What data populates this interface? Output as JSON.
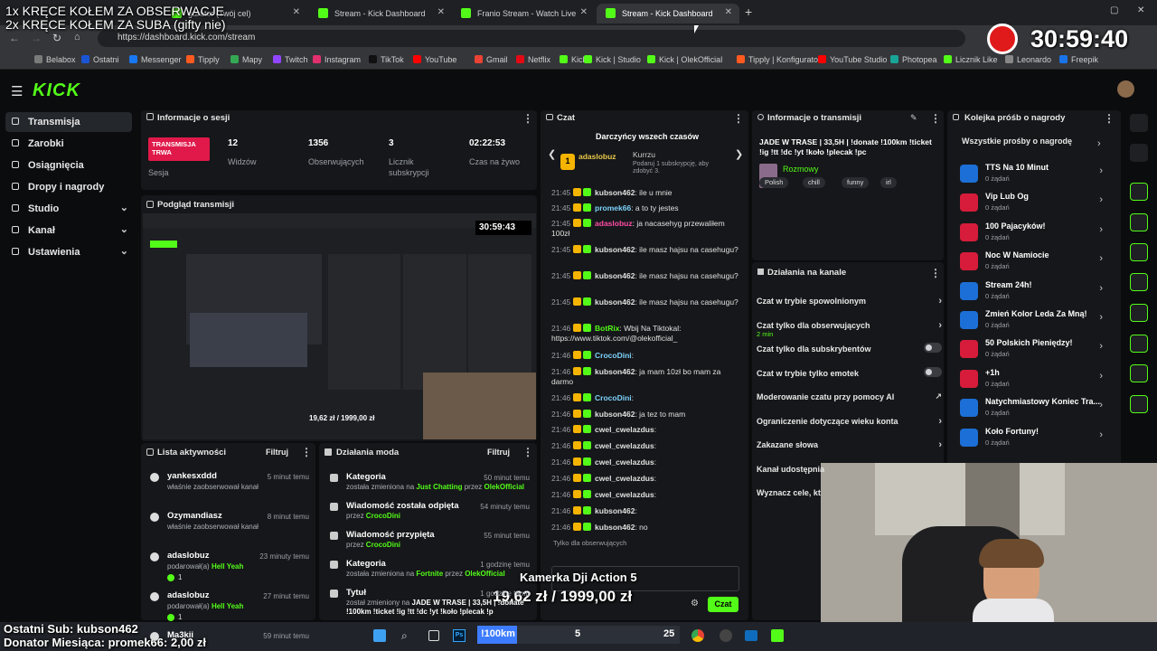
{
  "overlay": {
    "line1": "1x KRĘCE KOŁEM ZA OBSERWACJE",
    "line2": "2x KRĘCE KOŁEM ZA SUBA (gifty nie)",
    "timer": "30:59:40",
    "last_sub": "Ostatni Sub: kubson462",
    "donor": "Donator Miesiąca: promek66: 2,00 zł",
    "goal_title": "Kamerka Dji Action 5",
    "goal_value": "19,62 zł / 1999,00 zł",
    "km_label": "!100km",
    "km_value": "5",
    "km_right": "25"
  },
  "browser": {
    "tabs": [
      {
        "label": "gurator (Twój cel)",
        "active": false
      },
      {
        "label": "Stream - Kick Dashboard",
        "active": false
      },
      {
        "label": "Franio Stream - Watch Live",
        "active": false
      },
      {
        "label": "Stream - Kick Dashboard",
        "active": true
      }
    ],
    "url": "https://dashboard.kick.com/stream",
    "bookmarks": [
      "Belabox",
      "Ostatni",
      "Messenger",
      "Tipply",
      "Mapy",
      "Twitch",
      "Instagram",
      "TikTok",
      "YouTube",
      "Gmail",
      "Netflix",
      "Kick",
      "Kick | Studio",
      "Kick | OlekOfficial",
      "Tipply | Konfigurato...",
      "YouTube Studio",
      "Photopea",
      "Licznik Like",
      "Leonardo",
      "Freepik"
    ],
    "bookmark_colors": [
      "#7a7a7a",
      "#1a55d6",
      "#1877f2",
      "#ff5a1f",
      "#34a853",
      "#9146ff",
      "#e1306c",
      "#111111",
      "#ff0000",
      "#ea4335",
      "#e50914",
      "#53fc18",
      "#53fc18",
      "#53fc18",
      "#ff5a1f",
      "#ff0000",
      "#18a497",
      "#53fc18",
      "#888888",
      "#1a73e8"
    ]
  },
  "kick": {
    "logo": "KICK",
    "nav": [
      {
        "label": "Transmisja",
        "selected": true,
        "chevron": false
      },
      {
        "label": "Zarobki",
        "selected": false,
        "chevron": false
      },
      {
        "label": "Osiągnięcia",
        "selected": false,
        "chevron": false
      },
      {
        "label": "Dropy i nagrody",
        "selected": false,
        "chevron": false
      },
      {
        "label": "Studio",
        "selected": false,
        "chevron": true
      },
      {
        "label": "Kanał",
        "selected": false,
        "chevron": true
      },
      {
        "label": "Ustawienia",
        "selected": false,
        "chevron": true
      }
    ]
  },
  "session": {
    "title": "Informacje o sesji",
    "live_badge": "TRANSMISJA TRWA",
    "live_label": "Sesja",
    "stats": [
      {
        "value": "12",
        "label": "Widzów"
      },
      {
        "value": "1356",
        "label": "Obserwujących"
      },
      {
        "value": "3",
        "label": "Licznik subskrypcji"
      },
      {
        "value": "02:22:53",
        "label": "Czas na żywo"
      }
    ]
  },
  "preview": {
    "title": "Podgląd transmisji",
    "timer": "30:59:43",
    "amount": "19,62 zł / 1999,00 zł"
  },
  "activity": {
    "title": "Lista aktywności",
    "filter": "Filtruj",
    "items": [
      {
        "name": "yankesxddd",
        "sub": "właśnie zaobserwował kanał",
        "time": "5 minut temu",
        "extra": ""
      },
      {
        "name": "Ozymandiasz",
        "sub": "właśnie zaobserwował kanał",
        "time": "8 minut temu",
        "extra": ""
      },
      {
        "name": "adaslobuz",
        "sub": "podarował(a)",
        "gift": "Hell Yeah",
        "time": "23 minuty temu",
        "extra": "1"
      },
      {
        "name": "adaslobuz",
        "sub": "podarował(a)",
        "gift": "Hell Yeah",
        "time": "27 minut temu",
        "extra": "1"
      },
      {
        "name": "Ma3kii",
        "sub": "",
        "time": "59 minut temu",
        "extra": ""
      }
    ]
  },
  "mod": {
    "title": "Działania moda",
    "filter": "Filtruj",
    "items": [
      {
        "name": "Kategoria",
        "sub": "została zmieniona na",
        "hl": "Just Chatting",
        "by": "przez",
        "user": "OlekOfficial",
        "time": "50 minut temu"
      },
      {
        "name": "Wiadomość została odpięta",
        "sub": "przez",
        "hl": "",
        "by": "",
        "user": "CrocoDini",
        "time": "54 minuty temu"
      },
      {
        "name": "Wiadomość przypięta",
        "sub": "przez",
        "hl": "",
        "by": "",
        "user": "CrocoDini",
        "time": "55 minut temu"
      },
      {
        "name": "Kategoria",
        "sub": "została zmieniona na",
        "hl": "Fortnite",
        "by": "przez",
        "user": "OlekOfficial",
        "time": "1 godzinę temu"
      },
      {
        "name": "Tytuł",
        "sub": "został zmieniony na",
        "hl": "JADE W TRASE | 33,5H | !donate !100km !ticket !ig !tt !dc !yt !koło !plecak !p",
        "by": "",
        "user": "",
        "time": "1 godzinę temu"
      }
    ]
  },
  "chat": {
    "title": "Czat",
    "top_title": "Darczyńcy wszech czasów",
    "top1": "adaslobuz",
    "top2": "Kurrzu",
    "top2_sub": "Podaruj 1 subskrypcję, aby zdobyć 3.",
    "messages": [
      {
        "t": "21:45",
        "user": "kubson462",
        "color": "#e0e0e0",
        "msg": ": ile u mnie"
      },
      {
        "t": "21:45",
        "user": "promek66",
        "color": "#7dd3fc",
        "msg": ": a to ty jestes"
      },
      {
        "t": "21:45",
        "user": "adaslobuz",
        "color": "#ff4da6",
        "msg": ": ja nacasehyg przewaliłem 100zł"
      },
      {
        "t": "21:45",
        "user": "kubson462",
        "color": "#e0e0e0",
        "msg": ": ile masz hajsu na casehugu?"
      },
      {
        "t": "21:45",
        "user": "kubson462",
        "color": "#e0e0e0",
        "msg": ": ile masz hajsu na casehugu?"
      },
      {
        "t": "21:45",
        "user": "kubson462",
        "color": "#e0e0e0",
        "msg": ": ile masz hajsu na casehugu?"
      },
      {
        "t": "21:46",
        "user": "BotRix",
        "color": "#53fc18",
        "msg": ": Wbij Na Tiktokal: https://www.tiktok.com/@olekofficial_"
      },
      {
        "t": "21:46",
        "user": "CrocoDini",
        "color": "#7dd3fc",
        "msg": ":"
      },
      {
        "t": "21:46",
        "user": "kubson462",
        "color": "#e0e0e0",
        "msg": ": ja mam 10zł bo mam za darmo"
      },
      {
        "t": "21:46",
        "user": "CrocoDini",
        "color": "#7dd3fc",
        "msg": ":"
      },
      {
        "t": "21:46",
        "user": "kubson462",
        "color": "#e0e0e0",
        "msg": ": ja tez to mam"
      },
      {
        "t": "21:46",
        "user": "cwel_cwelazdus",
        "color": "#e0e0e0",
        "msg": ":"
      },
      {
        "t": "21:46",
        "user": "cwel_cwelazdus",
        "color": "#e0e0e0",
        "msg": ":"
      },
      {
        "t": "21:46",
        "user": "cwel_cwelazdus",
        "color": "#e0e0e0",
        "msg": ":"
      },
      {
        "t": "21:46",
        "user": "cwel_cwelazdus",
        "color": "#e0e0e0",
        "msg": ":"
      },
      {
        "t": "21:46",
        "user": "cwel_cwelazdus",
        "color": "#e0e0e0",
        "msg": ":"
      },
      {
        "t": "21:46",
        "user": "kubson462",
        "color": "#e0e0e0",
        "msg": ":"
      },
      {
        "t": "21:46",
        "user": "kubson462",
        "color": "#e0e0e0",
        "msg": ": no"
      }
    ],
    "followers_only": "Tylko dla obserwujących",
    "send": "Czat"
  },
  "stream_info": {
    "title": "Informacje o transmisji",
    "stream_title": "JADE W TRASE | 33,5H | !donate !100km !ticket !ig !tt !dc !yt !koło !plecak !pc",
    "category": "Rozmowy",
    "tags": [
      "Polish",
      "chill",
      "funny",
      "irl"
    ]
  },
  "channel": {
    "title": "Działania na kanale",
    "items": [
      {
        "label": "Czat w trybie spowolnionym",
        "sub": "",
        "ctl": "chev"
      },
      {
        "label": "Czat tylko dla obserwujących",
        "sub": "2 min",
        "ctl": "chev"
      },
      {
        "label": "Czat tylko dla subskrybentów",
        "sub": "",
        "ctl": "toggle"
      },
      {
        "label": "Czat w trybie tylko emotek",
        "sub": "",
        "ctl": "toggle"
      },
      {
        "label": "Moderowanie czatu przy pomocy AI",
        "sub": "",
        "ctl": "ext"
      },
      {
        "label": "Ograniczenie dotyczące wieku konta",
        "sub": "",
        "ctl": "chev"
      },
      {
        "label": "Zakazane słowa",
        "sub": "",
        "ctl": "chev"
      },
      {
        "label": "Kanał udostępnia",
        "sub": "",
        "ctl": ""
      },
      {
        "label": "Wyznacz cele, kt",
        "sub": "",
        "ctl": ""
      }
    ]
  },
  "rewards": {
    "title": "Kolejka próśb o nagrody",
    "all": "Wszystkie prośby o nagrodę",
    "items": [
      {
        "label": "TTS Na 10 Minut",
        "sub": "0 żądań",
        "color": "#1c6fd6"
      },
      {
        "label": "Vip Lub Og",
        "sub": "0 żądań",
        "color": "#d61c3a"
      },
      {
        "label": "100 Pajacyków!",
        "sub": "0 żądań",
        "color": "#d61c3a"
      },
      {
        "label": "Noc W Namiocie",
        "sub": "0 żądań",
        "color": "#d61c3a"
      },
      {
        "label": "Stream 24h!",
        "sub": "0 żądań",
        "color": "#1c6fd6"
      },
      {
        "label": "Zmień Kolor Leda Za Mną!",
        "sub": "0 żądań",
        "color": "#1c6fd6"
      },
      {
        "label": "50 Polskich Pieniędzy!",
        "sub": "0 żądań",
        "color": "#d61c3a"
      },
      {
        "label": "+1h",
        "sub": "0 żądań",
        "color": "#d61c3a"
      },
      {
        "label": "Natychmiastowy Koniec Tra...",
        "sub": "0 żądań",
        "color": "#1c6fd6"
      },
      {
        "label": "Koło Fortuny!",
        "sub": "0 żądań",
        "color": "#1c6fd6"
      }
    ]
  },
  "colors": {
    "accent": "#53fc18",
    "live": "#e0194a",
    "panel": "#16171a"
  }
}
